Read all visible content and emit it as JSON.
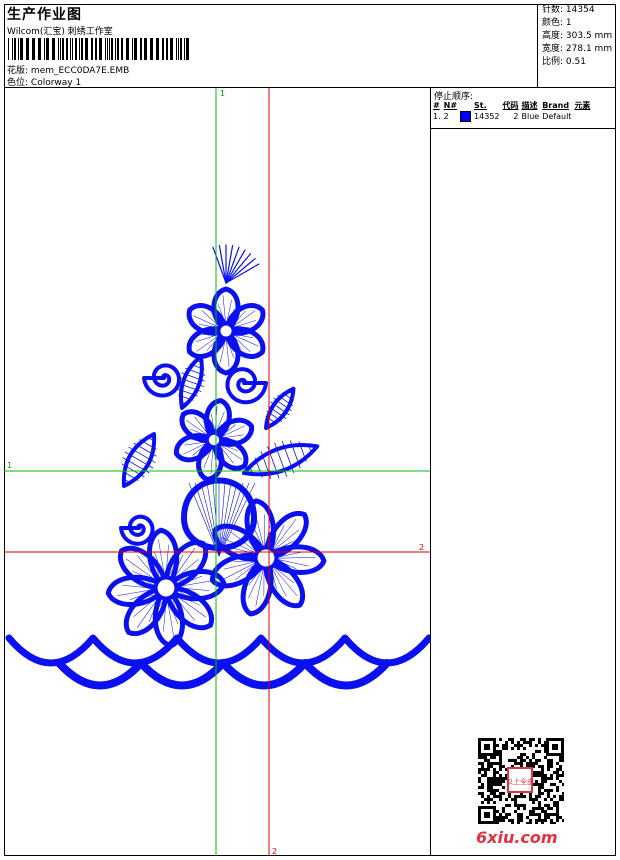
{
  "header": {
    "title": "生产作业图",
    "subtitle": "Wilcom(汇宝) 刺绣工作室",
    "design_label": "花版:",
    "design_value": "mem_ECC0DA7E.EMB",
    "colorway_label": "色位:",
    "colorway_value": "Colorway 1"
  },
  "stats": {
    "stitches_label": "针数:",
    "stitches_value": "14354",
    "colors_label": "颜色:",
    "colors_value": "1",
    "height_label": "高度:",
    "height_value": "303.5 mm",
    "width_label": "宽度:",
    "width_value": "278.1 mm",
    "scale_label": "比例:",
    "scale_value": "0.51"
  },
  "stop_sequence": {
    "title": "停止顺序:",
    "headers": [
      "#",
      "N#",
      "St.",
      "代码",
      "描述",
      "Brand",
      "元素"
    ],
    "rows": [
      {
        "index": "1.",
        "n": "2",
        "swatch_color": "#0000ff",
        "stitches": "14352",
        "code": "2",
        "description": "Blue",
        "brand": "Default"
      }
    ]
  },
  "guides": {
    "green_top": "1",
    "green_left": "1",
    "red_bottom": "2",
    "red_right": "2"
  },
  "embroidery_color": "#0a10f0",
  "watermark": {
    "brand": "6xiu.com",
    "seal_text": "以上全由"
  }
}
